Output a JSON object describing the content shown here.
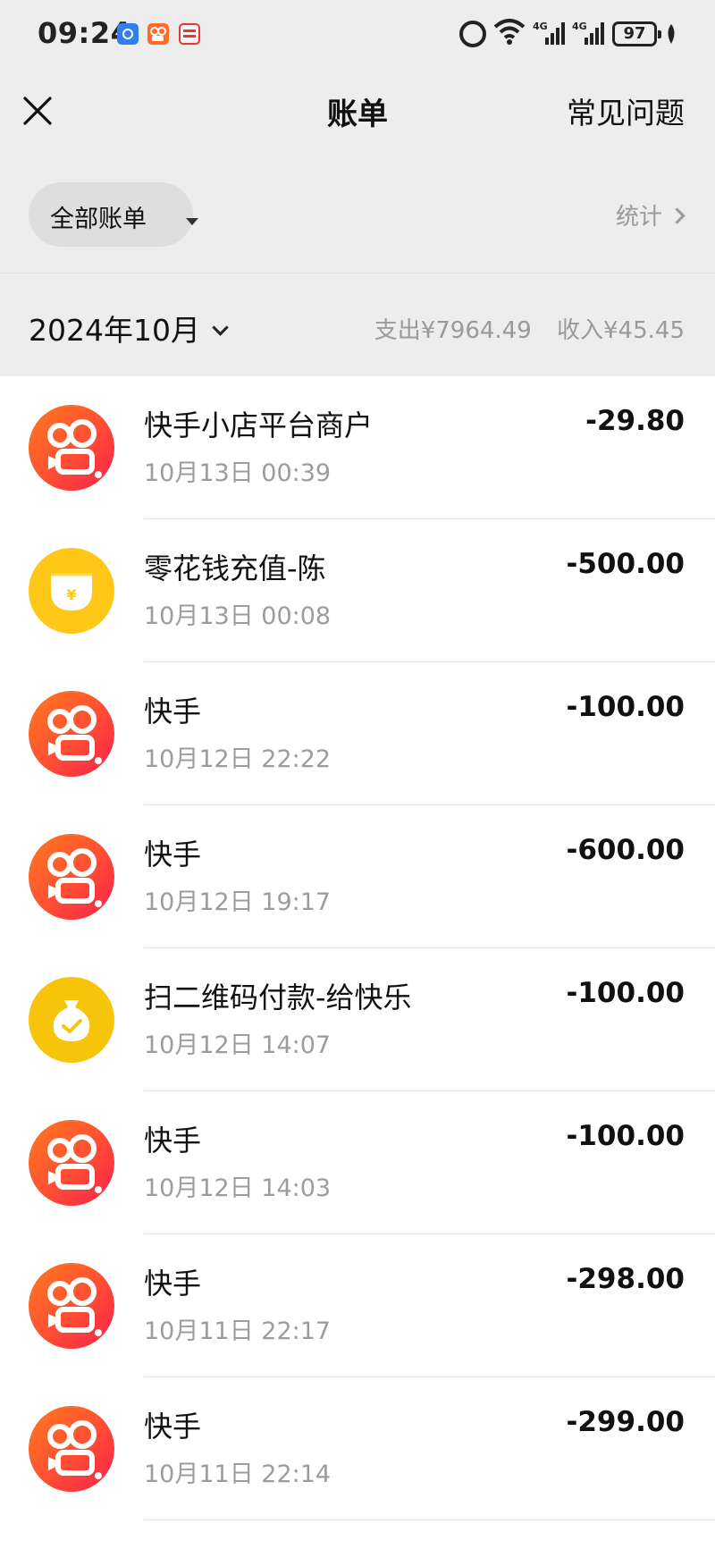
{
  "status_bar": {
    "time": "09:24",
    "battery": "97",
    "icons": [
      "clock-app-icon",
      "kuaishou-app-icon",
      "toutiao-app-icon",
      "alarm-icon",
      "wifi-icon",
      "signal-4g-icon",
      "signal-4g-icon",
      "battery-icon",
      "leaf-icon"
    ]
  },
  "header": {
    "title": "账单",
    "faq_label": "常见问题"
  },
  "filter": {
    "bill_type": "全部账单",
    "stats_label": "统计"
  },
  "month": {
    "label": "2024年10月",
    "expense": "支出¥7964.49",
    "income": "收入¥45.45"
  },
  "transactions": [
    {
      "name": "快手小店平台商户",
      "time": "10月13日 00:39",
      "amount": "-29.80",
      "icon": "kuaishou-icon"
    },
    {
      "name": "零花钱充值-陈",
      "time": "10月13日 00:08",
      "amount": "-500.00",
      "icon": "coin-pocket-icon"
    },
    {
      "name": "快手",
      "time": "10月12日 22:22",
      "amount": "-100.00",
      "icon": "kuaishou-icon"
    },
    {
      "name": "快手",
      "time": "10月12日 19:17",
      "amount": "-600.00",
      "icon": "kuaishou-icon"
    },
    {
      "name": "扫二维码付款-给快乐",
      "time": "10月12日 14:07",
      "amount": "-100.00",
      "icon": "money-bag-icon"
    },
    {
      "name": "快手",
      "time": "10月12日 14:03",
      "amount": "-100.00",
      "icon": "kuaishou-icon"
    },
    {
      "name": "快手",
      "time": "10月11日 22:17",
      "amount": "-298.00",
      "icon": "kuaishou-icon"
    },
    {
      "name": "快手",
      "time": "10月11日 22:14",
      "amount": "-299.00",
      "icon": "kuaishou-icon"
    }
  ],
  "colors": {
    "background": "#ededed",
    "kuaishou_gradient_start": "#ff7a1f",
    "kuaishou_gradient_end": "#f4224b",
    "coin_yellow": "#ffc818",
    "muted_text": "#9c9c9c"
  }
}
